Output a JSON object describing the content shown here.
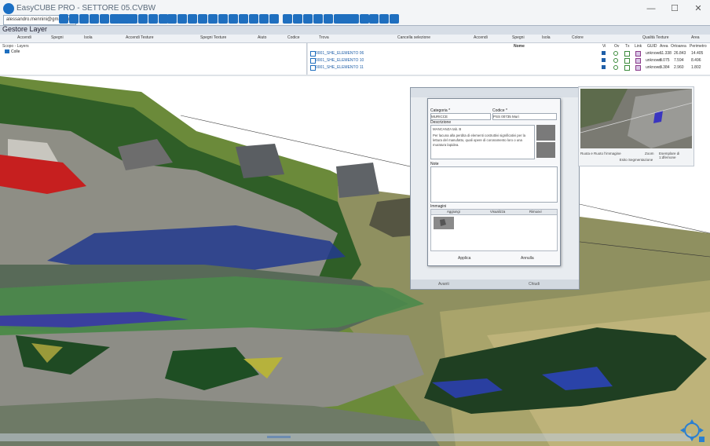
{
  "window": {
    "title": "EasyCUBE PRO - SETTORE 05.CVBW",
    "minimize": "—",
    "maximize": "☐",
    "close": "✕"
  },
  "user": {
    "email": "alessandro.mennini@gmail.com"
  },
  "toolbar": {
    "buttons": [
      "home-icon",
      "edit-icon",
      "layers-icon",
      "cloud-icon",
      "camera-icon",
      "grid-icon",
      "table-icon",
      "chart-icon",
      "map-icon",
      "settings-icon",
      "list-icon",
      "user-icon",
      "tag-icon",
      "link-icon",
      "chevron-left-icon",
      "download-icon",
      "filter-icon",
      "refresh-icon",
      "arrow-icon",
      "pin-icon",
      "print-icon",
      "export-icon",
      "box-icon",
      "measure-icon",
      "shapes-icon",
      "cube-icon",
      "layers2-icon",
      "info-icon",
      "help-icon",
      "search-icon",
      "zoom-icon",
      "eye-icon",
      "lock-icon",
      "star-icon",
      "folder-icon",
      "share-icon"
    ]
  },
  "panel": {
    "title": "Gestore Layer",
    "columns_left": [
      "Accendi",
      "Spegni",
      "Isola",
      "Accendi Testure",
      "Spegni Texture",
      "Aiuto",
      "Codice"
    ],
    "columns_right": [
      "Trova",
      "Cancella selezione",
      "Accendi",
      "Spegni",
      "Isola",
      "Colore",
      "Qualità Texture",
      "Area"
    ],
    "tree_root": "Scopo - Layers",
    "tree_child": "Colle"
  },
  "grid": {
    "nome_header": "Nome",
    "col_headers": [
      "Vi",
      "Ov",
      "Tx",
      "Link",
      "GUID",
      "Area",
      "Ortoarea",
      "Perimetro"
    ],
    "rows": [
      {
        "name": "0001_SHE_ELEMENTO 06",
        "guid": "unknown",
        "area": "11.338",
        "orto": "26.843",
        "perimetro": "14.405"
      },
      {
        "name": "0001_SHE_ELEMENTO 10",
        "guid": "unknown",
        "area": "8.075",
        "orto": "7.594",
        "perimetro": "8.496"
      },
      {
        "name": "0001_SHE_ELEMENTO 11",
        "guid": "unknown",
        "area": "3.384",
        "orto": "2.960",
        "perimetro": "1.802"
      }
    ]
  },
  "dialog": {
    "categoria_label": "Categoria *",
    "codice_label": "Codice *",
    "categoria_value": "MURICCE",
    "codice_value": "PSS 00735 Muri",
    "descrizione_label": "Descrizione",
    "descrizione_title": "MANCANZA tab. B",
    "descrizione_body": "Per lacuna alla perdita di elementi costruttivi significativi per la lettura del manufatto, quali opere di coronamento loro o una muratura lapidea.",
    "note_label": "Note",
    "immagini_label": "Immagini",
    "img_cols": [
      "Aggiungi",
      "Visualizza",
      "Rimuovi"
    ],
    "ok_label": "Applica",
    "cancel_label": "Annulla",
    "back_bottom_left": "Avanti",
    "back_bottom_right": "Chiudi"
  },
  "right_panel": {
    "rotate_label": "Ruota e Ruoto l'immagine",
    "zoom_label": "Zoom",
    "scale_label": "Esemplare di 1:dfernone",
    "seg_label": "Esito Segmentazione"
  }
}
